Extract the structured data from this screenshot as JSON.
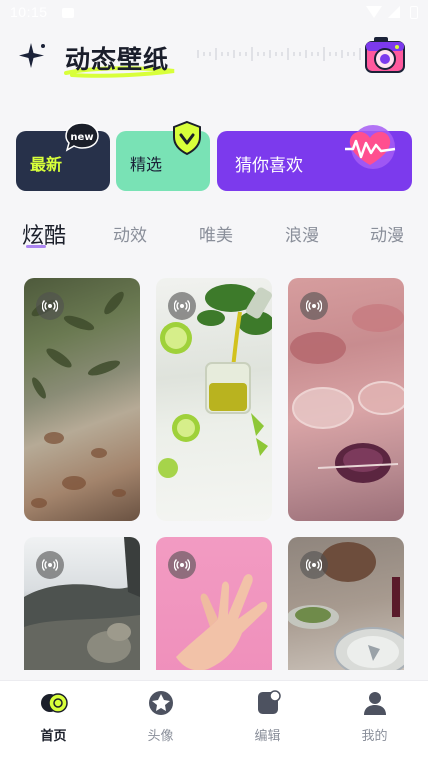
{
  "status_bar": {
    "time": "10:15"
  },
  "header": {
    "title": "动态壁纸",
    "camera_icon": "camera-icon"
  },
  "categories": {
    "new": {
      "label": "最新",
      "badge": "new"
    },
    "select": {
      "label": "精选"
    },
    "guess": {
      "label": "猜你喜欢"
    }
  },
  "tabs": [
    "炫酷",
    "动效",
    "唯美",
    "浪漫",
    "动漫"
  ],
  "active_tab": "炫酷",
  "wallpapers": [
    {
      "subject": "eucalyptus-bark",
      "live": true
    },
    {
      "subject": "lime-juice",
      "live": true
    },
    {
      "subject": "rose-wine-glasses",
      "live": true
    },
    {
      "subject": "rocky-cliff",
      "live": true
    },
    {
      "subject": "hand-on-pink",
      "live": true
    },
    {
      "subject": "dinner-table",
      "live": true
    }
  ],
  "bottom_nav": [
    {
      "label": "首页",
      "icon": "home-icon",
      "active": true
    },
    {
      "label": "头像",
      "icon": "avatar-aperture-icon",
      "active": false
    },
    {
      "label": "编辑",
      "icon": "edit-icon",
      "active": false
    },
    {
      "label": "我的",
      "icon": "profile-icon",
      "active": false
    }
  ],
  "colors": {
    "accent": "#7c3aed",
    "new_card": "#27314a",
    "select_card": "#79e2b5",
    "lime": "#d8ff3a"
  }
}
